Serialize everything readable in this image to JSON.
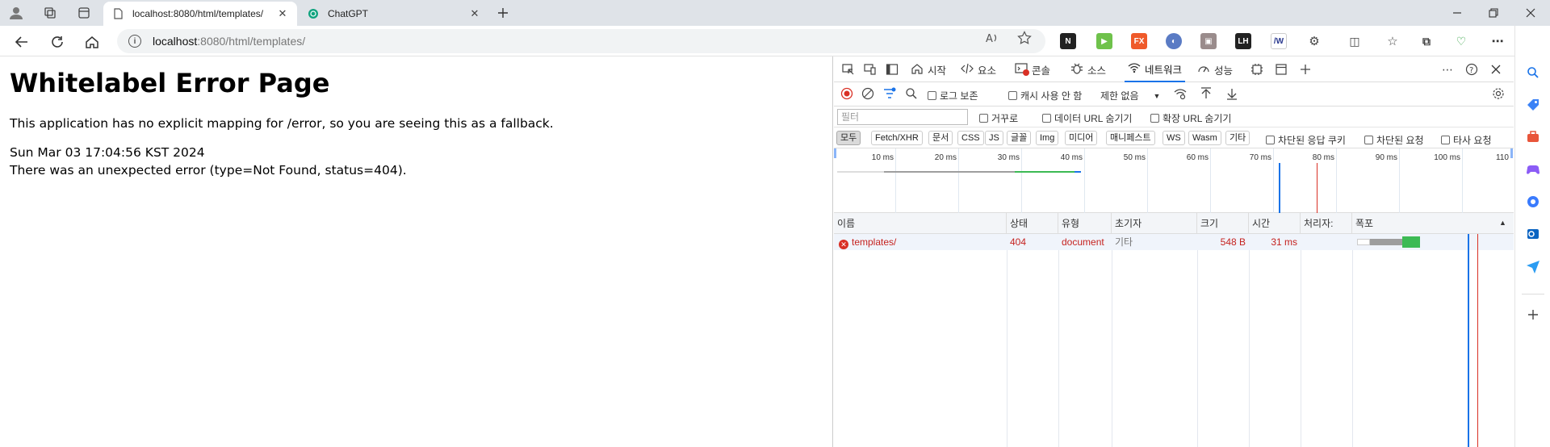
{
  "browser": {
    "tabs": [
      {
        "title": "localhost:8080/html/templates/",
        "active": true
      },
      {
        "title": "ChatGPT",
        "active": false
      }
    ],
    "url_host": "localhost",
    "url_path": ":8080/html/templates/"
  },
  "page": {
    "heading": "Whitelabel Error Page",
    "message": "This application has no explicit mapping for /error, so you are seeing this as a fallback.",
    "timestamp": "Sun Mar 03 17:04:56 KST 2024",
    "error": "There was an unexpected error (type=Not Found, status=404)."
  },
  "devtools": {
    "tabs": [
      {
        "label": "시작",
        "icon": "home-icon"
      },
      {
        "label": "요소",
        "icon": "code-icon"
      },
      {
        "label": "콘솔",
        "icon": "console-icon"
      },
      {
        "label": "소스",
        "icon": "bug-icon"
      },
      {
        "label": "네트워크",
        "icon": "wifi-icon",
        "active": true
      },
      {
        "label": "성능",
        "icon": "performance-icon"
      }
    ],
    "toolbar": {
      "preserve_log": "로그 보존",
      "disable_cache": "캐시 사용 안 함",
      "throttle": "제한 없음"
    },
    "filter": {
      "placeholder": "필터",
      "invert": "거꾸로",
      "hide_data_urls": "데이터 URL 숨기기",
      "hide_ext_urls": "확장 URL 숨기기"
    },
    "types": [
      "모두",
      "Fetch/XHR",
      "문서",
      "CSS",
      "JS",
      "글꼴",
      "Img",
      "미디어",
      "매니페스트",
      "WS",
      "Wasm",
      "기타"
    ],
    "type_checks": {
      "blocked_cookies": "차단된 응답 쿠키",
      "blocked_requests": "차단된 요청",
      "third_party": "타사 요청"
    },
    "timeline_ticks": [
      "10 ms",
      "20 ms",
      "30 ms",
      "40 ms",
      "50 ms",
      "60 ms",
      "70 ms",
      "80 ms",
      "90 ms",
      "100 ms",
      "110"
    ],
    "columns": [
      "이름",
      "상태",
      "유형",
      "초기자",
      "크기",
      "시간",
      "처리자:",
      "폭포"
    ],
    "rows": [
      {
        "name": "templates/",
        "status": "404",
        "type": "document",
        "initiator": "기타",
        "size": "548 B",
        "time": "31 ms",
        "handler": ""
      }
    ]
  },
  "colors": {
    "accent": "#1a73e8",
    "error": "#c5221f",
    "waiting": "#9e9e9e",
    "download": "#3cba54"
  }
}
